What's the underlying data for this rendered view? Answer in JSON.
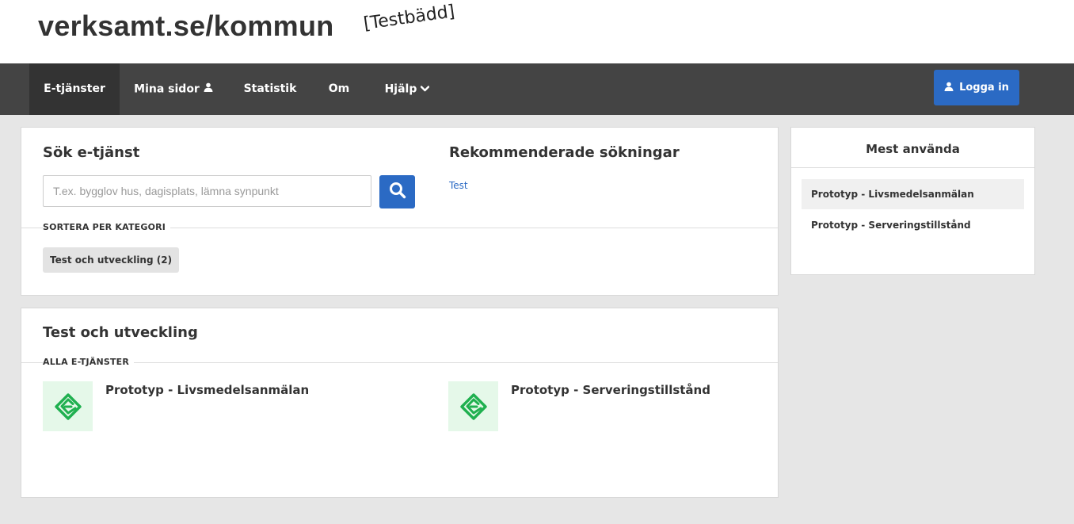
{
  "header": {
    "site_title": "verksamt.se/kommun",
    "env_badge": "[Testbädd]"
  },
  "nav": {
    "items": [
      {
        "label": "E-tjänster",
        "active": true
      },
      {
        "label": "Mina sidor",
        "icon": "user-icon"
      },
      {
        "label": "Statistik"
      },
      {
        "label": "Om"
      },
      {
        "label": "Hjälp",
        "icon": "chevron-down-icon"
      }
    ],
    "login_label": "Logga in"
  },
  "search": {
    "title": "Sök e-tjänst",
    "placeholder": "T.ex. bygglov hus, dagisplats, lämna synpunkt",
    "value": "",
    "button_icon": "search-icon",
    "recommended_title": "Rekommenderade sökningar",
    "recommended_links": [
      "Test"
    ],
    "sort_label": "SORTERA PER KATEGORI",
    "categories": [
      "Test och utveckling (2)"
    ]
  },
  "most_used": {
    "title": "Mest använda",
    "items": [
      "Prototyp - Livsmedelsanmälan",
      "Prototyp - Serveringstillstånd"
    ]
  },
  "category_section": {
    "title": "Test och utveckling",
    "all_label": "ALLA E-TJÄNSTER",
    "services": [
      {
        "name": "Prototyp - Livsmedelsanmälan",
        "icon": "e-service-logo-icon"
      },
      {
        "name": "Prototyp - Serveringstillstånd",
        "icon": "e-service-logo-icon"
      }
    ]
  },
  "colors": {
    "navbar": "#444444",
    "nav_active": "#333333",
    "accent_blue": "#2b6ac4",
    "icon_green": "#1fb04f",
    "icon_bg": "#e5f8e9"
  }
}
